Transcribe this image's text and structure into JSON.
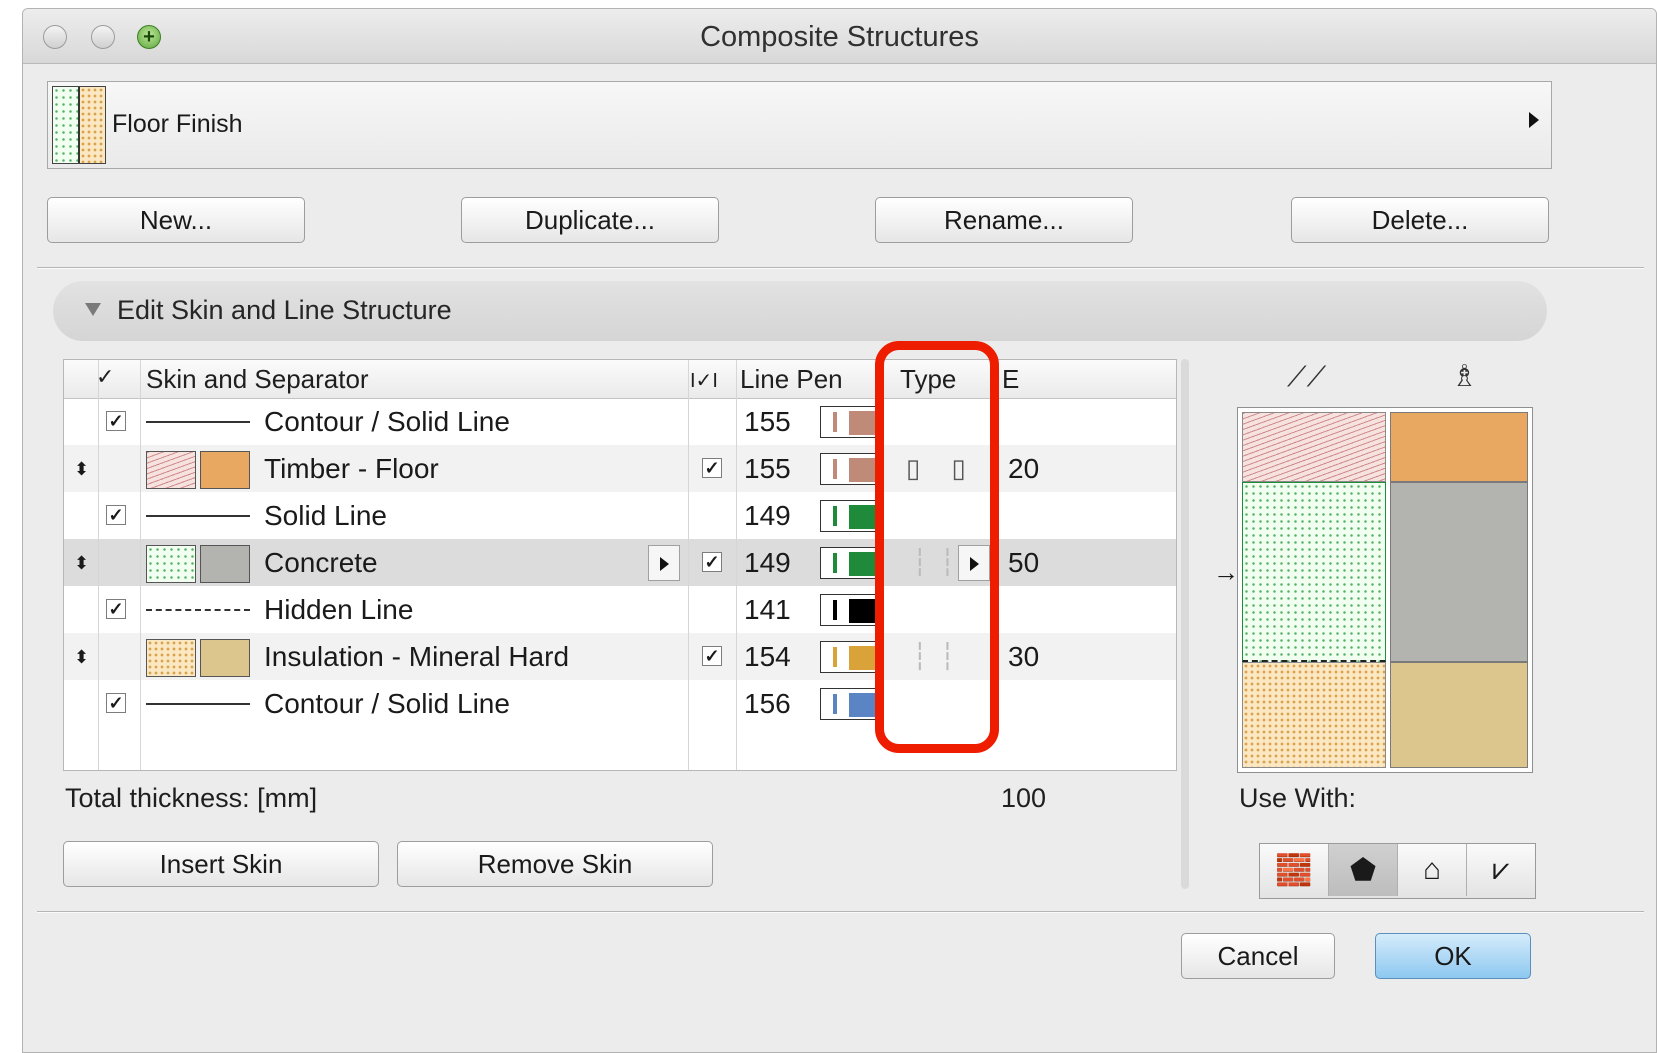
{
  "window": {
    "title": "Composite Structures"
  },
  "structure": {
    "name": "Floor Finish"
  },
  "buttons": {
    "new": "New...",
    "duplicate": "Duplicate...",
    "rename": "Rename...",
    "delete": "Delete..."
  },
  "section": {
    "title": "Edit Skin and Line Structure"
  },
  "table": {
    "headers": {
      "skin": "Skin and Separator",
      "check_col": "I✓I",
      "line_pen": "Line Pen",
      "type": "Type",
      "thickness": "E"
    },
    "rows": [
      {
        "kind": "line",
        "line_style": "solid",
        "label": "Contour / Solid Line",
        "pen": "155",
        "pen_color": "#c08a78",
        "checked": true
      },
      {
        "kind": "skin",
        "label": "Timber - Floor",
        "pen": "155",
        "pen_color": "#c08a78",
        "checked": true,
        "type_icon": "▯ ▯",
        "thickness": "20",
        "fill": "#e8a862",
        "pattern": "timber"
      },
      {
        "kind": "line",
        "line_style": "solid",
        "label": "Solid Line",
        "pen": "149",
        "pen_color": "#1f8a3a",
        "checked": true
      },
      {
        "kind": "skin",
        "label": "Concrete",
        "pen": "149",
        "pen_color": "#1f8a3a",
        "checked": true,
        "type_icon": "┆┆",
        "thickness": "50",
        "fill": "#b3b3b0",
        "pattern": "concrete",
        "selected": true
      },
      {
        "kind": "line",
        "line_style": "dashed",
        "label": "Hidden Line",
        "pen": "141",
        "pen_color": "#000000",
        "checked": true
      },
      {
        "kind": "skin",
        "label": "Insulation - Mineral Hard",
        "pen": "154",
        "pen_color": "#d9a33a",
        "checked": true,
        "type_icon": "┆┆",
        "thickness": "30",
        "fill": "#dcc68d",
        "pattern": "insulation"
      },
      {
        "kind": "line",
        "line_style": "solid",
        "label": "Contour / Solid Line",
        "pen": "156",
        "pen_color": "#5b84c4",
        "checked": true
      }
    ]
  },
  "total": {
    "label": "Total thickness: [mm]",
    "value": "100"
  },
  "skin_buttons": {
    "insert": "Insert Skin",
    "remove": "Remove Skin"
  },
  "use_with": {
    "label": "Use With:",
    "icons": [
      "wall-icon",
      "slab-icon",
      "roof-icon",
      "shell-icon"
    ],
    "active_index": 1
  },
  "preview_icons": {
    "left": "cut-fill-icon",
    "right": "cover-fill-brush-icon"
  },
  "dialog_buttons": {
    "cancel": "Cancel",
    "ok": "OK"
  },
  "colors": {
    "accent": "#8ec8f0",
    "highlight": "#ee1d00"
  }
}
